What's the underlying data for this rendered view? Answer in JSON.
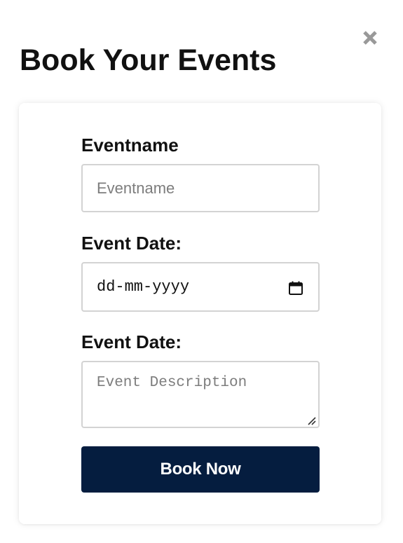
{
  "modal": {
    "title": "Book Your Events",
    "close_icon": "close-icon"
  },
  "form": {
    "event_name": {
      "label": "Eventname",
      "placeholder": "Eventname",
      "value": ""
    },
    "event_date": {
      "label": "Event Date:",
      "display_value": "dd-mm-yyyy",
      "icon": "calendar-icon"
    },
    "event_description": {
      "label": "Event Date:",
      "placeholder": "Event Description",
      "value": "",
      "icon": "resize-handle-icon"
    },
    "submit_label": "Book Now"
  },
  "colors": {
    "button_background": "#051d3f",
    "button_text": "#ffffff",
    "close_icon": "#999999",
    "input_border": "#d3d3d3",
    "title_text": "#111111"
  }
}
